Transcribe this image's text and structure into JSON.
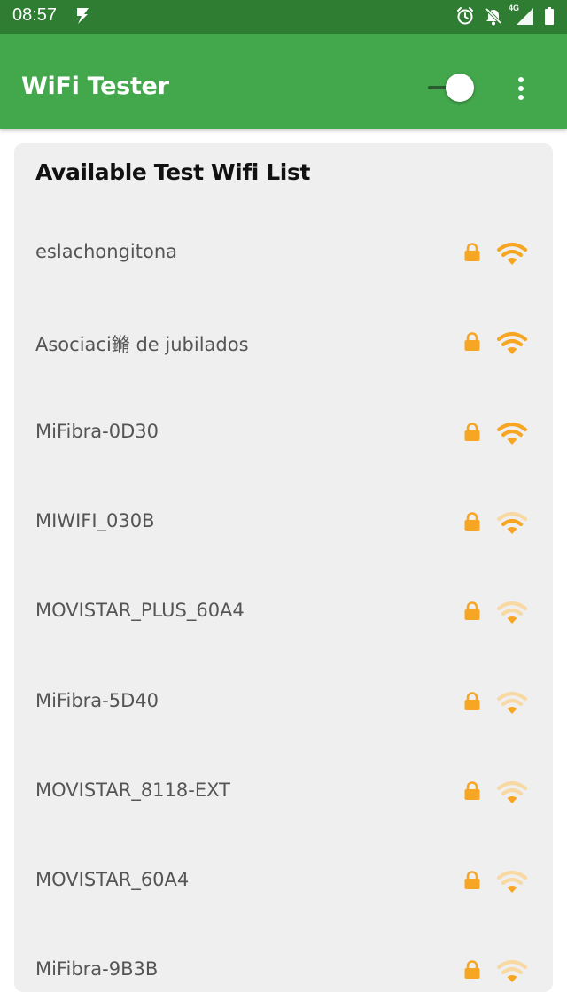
{
  "status_bar": {
    "time": "08:57",
    "network": "4G"
  },
  "app_bar": {
    "title": "WiFi Tester",
    "toggle_on": true
  },
  "card": {
    "title": "Available Test Wifi List"
  },
  "colors": {
    "status_bar": "#2e7d32",
    "app_bar": "#43a74b",
    "accent": "#f6a623",
    "accent_light": "#f8d9a3",
    "card_bg": "#efefef"
  },
  "networks": [
    {
      "ssid": "eslachongitona",
      "secured": true,
      "signal_bars": 3,
      "icon": "wifi-icon"
    },
    {
      "ssid": "Asociaci鏅 de jubilados",
      "secured": true,
      "signal_bars": 3,
      "icon": "wifi-icon"
    },
    {
      "ssid": "MiFibra-0D30",
      "secured": true,
      "signal_bars": 3,
      "icon": "wifi-icon"
    },
    {
      "ssid": "MIWIFI_030B",
      "secured": true,
      "signal_bars": 2,
      "icon": "wifi-icon"
    },
    {
      "ssid": "MOVISTAR_PLUS_60A4",
      "secured": true,
      "signal_bars": 1,
      "icon": "wifi-icon"
    },
    {
      "ssid": "MiFibra-5D40",
      "secured": true,
      "signal_bars": 1,
      "icon": "wifi-icon"
    },
    {
      "ssid": "MOVISTAR_8118-EXT",
      "secured": true,
      "signal_bars": 1,
      "icon": "wifi-icon"
    },
    {
      "ssid": "MOVISTAR_60A4",
      "secured": true,
      "signal_bars": 1,
      "icon": "wifi-icon"
    },
    {
      "ssid": "MiFibra-9B3B",
      "secured": true,
      "signal_bars": 1,
      "icon": "wifi-icon"
    }
  ]
}
